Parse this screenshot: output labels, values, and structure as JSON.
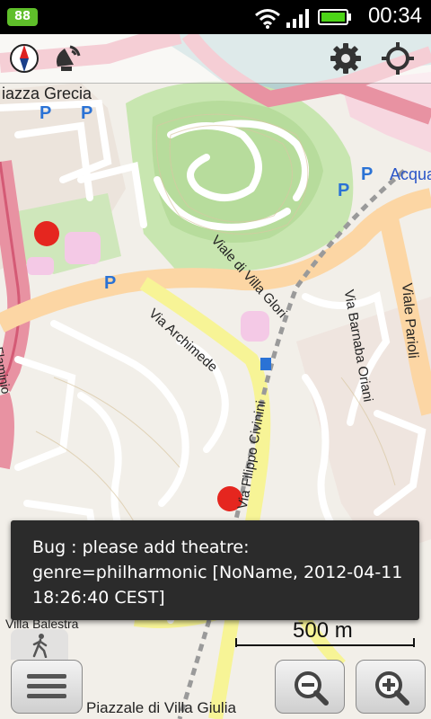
{
  "statusbar": {
    "battery_badge": "88",
    "time": "00:34",
    "icons": [
      "wifi-icon",
      "signal-icon",
      "battery-icon"
    ]
  },
  "toolbar": {
    "left_icons": [
      "compass-icon",
      "satellite-dish-icon"
    ],
    "right_icons": [
      "gear-icon",
      "locate-icon"
    ]
  },
  "map": {
    "labels": {
      "piazza_grecia": "iazza Grecia",
      "viale_villa_glori": "Viale di Villa Glori",
      "acqua": "Acqua",
      "via_barnaba_oriani": "Via Barnaba Oriani",
      "viale_parioli": "Viale Parioli",
      "via_archimede": "Via Archimede",
      "via_filippo_civinini": "Via Filippo Civinini",
      "piazzale_villa_giulia": "Piazzale di Villa Giulia",
      "villa_balestra": "Villa Balestra",
      "flaminio": "Flaminio"
    },
    "colors": {
      "park": "#c8e6b0",
      "primary_road": "#e892a2",
      "secondary_road": "#fcd6a4",
      "tertiary_road": "#f7f496",
      "bug_marker": "#e5261f"
    }
  },
  "toast": {
    "text": "Bug : please add theatre: genre=philharmonic [NoName, 2012-04-11 18:26:40 CEST]"
  },
  "scale": {
    "label": "500 m"
  },
  "bottom": {
    "menu_icon": "menu-icon",
    "walk_icon": "pedestrian-icon",
    "zoom_out_icon": "zoom-out-icon",
    "zoom_in_icon": "zoom-in-icon"
  }
}
